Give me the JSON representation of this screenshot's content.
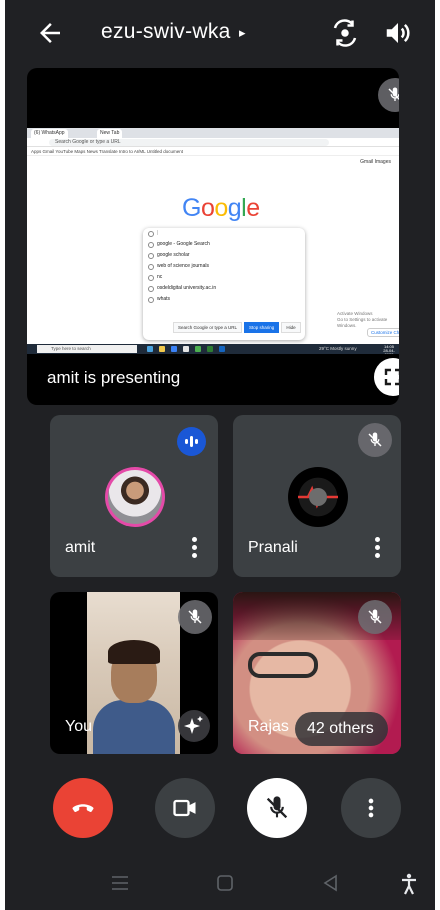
{
  "meeting": {
    "code": "ezu-swiv-wka",
    "caret": "▸"
  },
  "topbar": {
    "back_icon": "arrow-left-icon",
    "switch_camera_icon": "camera-switch-icon",
    "audio_output_icon": "speaker-icon"
  },
  "presentation": {
    "label": "amit is presenting",
    "muted": true,
    "shared_screen": {
      "tabs": [
        "(6) WhatsApp",
        "New Tab"
      ],
      "url": "Search Google or type a URL",
      "bookmarks": "Apps  Gmail  YouTube  Maps  News  Translate  Intro to AI/ML  Untitled document",
      "header_links": "Gmail  Images",
      "logo": "Google",
      "suggestions": [
        "google - Google Search",
        "google scholar",
        "web of science journals",
        "nc",
        "osdeldigital university.ac.in",
        "whats"
      ],
      "buttons": [
        "Search Google or type a URL",
        "Stop sharing",
        "Hide"
      ],
      "activate_notice": [
        "Activate Windows",
        "Go to Settings to activate Windows."
      ],
      "customize": "Customize Chrome",
      "taskbar_search": "Type here to search",
      "weather": "29°C Mostly sunny",
      "clock": [
        "14:05",
        "28-04-2023"
      ]
    }
  },
  "participants": [
    {
      "name": "amit",
      "speaking": true,
      "muted": false
    },
    {
      "name": "Pranali",
      "muted": true
    },
    {
      "name": "You",
      "muted": true
    },
    {
      "name": "Rajas",
      "muted": true,
      "others_label": "42 others"
    }
  ],
  "controls": {
    "end_call_icon": "phone-hangup-icon",
    "camera_icon": "video-camera-icon",
    "mic_icon": "mic-off-icon",
    "more_icon": "more-vert-icon"
  },
  "colors": {
    "background": "#202124",
    "tile": "#3c4043",
    "end_call": "#ea4335",
    "speaking_badge": "#1a57d6"
  }
}
